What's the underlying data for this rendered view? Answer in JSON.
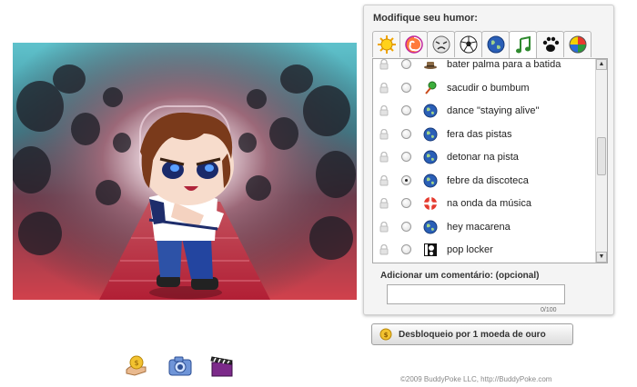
{
  "panel": {
    "title": "Modifique seu humor:",
    "tabs": [
      {
        "icon": "sun-icon"
      },
      {
        "icon": "swirl-icon"
      },
      {
        "icon": "angry-face-icon"
      },
      {
        "icon": "soccer-ball-icon"
      },
      {
        "icon": "globe-icon"
      },
      {
        "icon": "music-note-icon"
      },
      {
        "icon": "paw-icon"
      },
      {
        "icon": "beach-ball-icon"
      }
    ],
    "active_tab": 5,
    "moods": [
      {
        "label": "bater palma para a batida",
        "icon": "hat-icon",
        "locked": true,
        "selected": false
      },
      {
        "label": "sacudir o bumbum",
        "icon": "maraca-icon",
        "locked": true,
        "selected": false
      },
      {
        "label": "dance \"staying alive\"",
        "icon": "globe-icon",
        "locked": true,
        "selected": false
      },
      {
        "label": "fera das pistas",
        "icon": "globe-icon",
        "locked": true,
        "selected": false
      },
      {
        "label": "detonar na pista",
        "icon": "globe-icon",
        "locked": true,
        "selected": false
      },
      {
        "label": "febre da discoteca",
        "icon": "globe-icon",
        "locked": true,
        "selected": true
      },
      {
        "label": "na onda da música",
        "icon": "lifebuoy-icon",
        "locked": true,
        "selected": false
      },
      {
        "label": "hey macarena",
        "icon": "globe-icon",
        "locked": true,
        "selected": false
      },
      {
        "label": "pop locker",
        "icon": "speaker-icon",
        "locked": true,
        "selected": false
      }
    ],
    "comment_label": "Adicionar um comentário: (opcional)",
    "comment_value": "",
    "comment_counter": "0/100"
  },
  "unlock_button": {
    "label": "Desbloqueio por 1 moeda de ouro",
    "icon": "gold-coin-icon"
  },
  "toolbar": [
    {
      "name": "coin-hand-icon"
    },
    {
      "name": "camera-icon"
    },
    {
      "name": "video-clapper-icon"
    }
  ],
  "footer": "©2009 BuddyPoke LLC, http://BuddyPoke.com",
  "colors": {
    "accent_blue": "#2a5fb7",
    "stage_top": "#5fc2cc",
    "stage_bottom": "#d1414c"
  }
}
